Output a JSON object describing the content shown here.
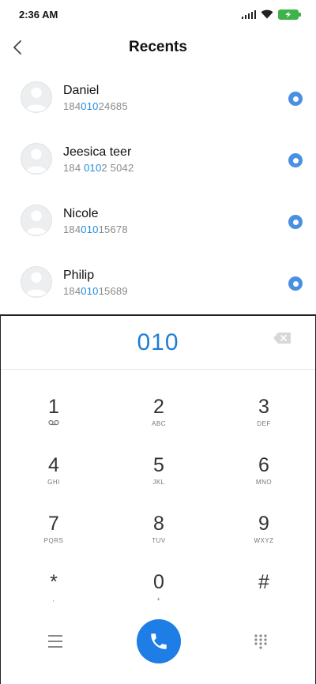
{
  "status_bar": {
    "time": "2:36 AM",
    "icons": [
      "signal-icon",
      "wifi-icon",
      "battery-charging-icon"
    ],
    "battery_color": "#3fb24a"
  },
  "header": {
    "title": "Recents",
    "back_icon": "chevron-left-icon"
  },
  "contacts": [
    {
      "name": "Daniel",
      "number_prefix": "184",
      "number_match": "010",
      "number_suffix": "24685"
    },
    {
      "name": "Jeesica teer",
      "number_prefix": "184 ",
      "number_match": "010",
      "number_suffix": "2 5042"
    },
    {
      "name": "Nicole",
      "number_prefix": "184",
      "number_match": "010",
      "number_suffix": "15678"
    },
    {
      "name": "Philip",
      "number_prefix": "184",
      "number_match": "010",
      "number_suffix": "15689"
    }
  ],
  "dialer": {
    "entered_number": "010",
    "keys": [
      {
        "digit": "1",
        "sub": "voicemail-icon"
      },
      {
        "digit": "2",
        "sub": "ABC"
      },
      {
        "digit": "3",
        "sub": "DEF"
      },
      {
        "digit": "4",
        "sub": "GHI"
      },
      {
        "digit": "5",
        "sub": "JKL"
      },
      {
        "digit": "6",
        "sub": "MNO"
      },
      {
        "digit": "7",
        "sub": "PQRS"
      },
      {
        "digit": "8",
        "sub": "TUV"
      },
      {
        "digit": "9",
        "sub": "WXYZ"
      },
      {
        "digit": "*",
        "sub": ","
      },
      {
        "digit": "0",
        "sub": "+"
      },
      {
        "digit": "#",
        "sub": ""
      }
    ],
    "accent_color": "#1e7ee6",
    "bottom_icons": [
      "menu-icon",
      "phone-icon",
      "keypad-icon"
    ]
  }
}
